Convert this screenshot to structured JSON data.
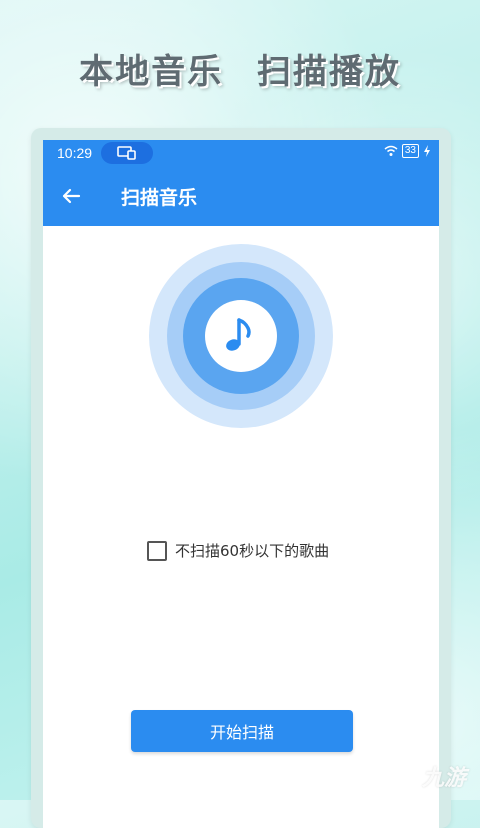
{
  "promo": {
    "left_title": "本地音乐",
    "right_title": "扫描播放"
  },
  "statusbar": {
    "time": "10:29",
    "battery": "33"
  },
  "appbar": {
    "title": "扫描音乐"
  },
  "option": {
    "label": "不扫描60秒以下的歌曲",
    "checked": false
  },
  "start_button": {
    "label": "开始扫描"
  },
  "watermark": {
    "text": "九游"
  },
  "colors": {
    "primary": "#2b8cf0",
    "ring_outer": "#d4e7fb",
    "ring_mid": "#a6cdf7",
    "ring_inner": "#5aa5f0"
  }
}
